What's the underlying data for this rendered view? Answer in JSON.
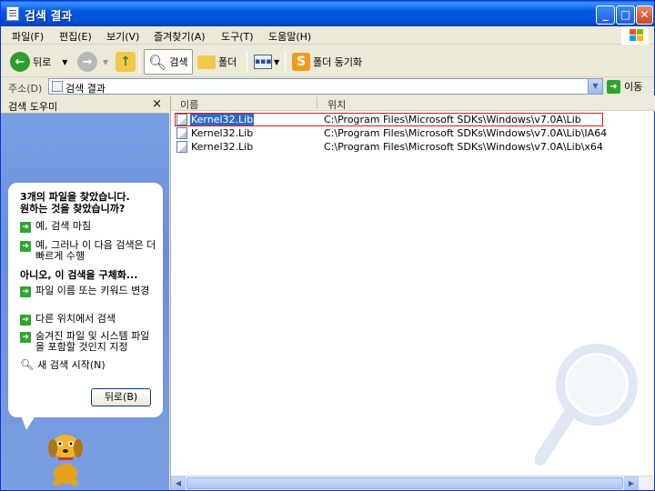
{
  "window": {
    "title": "검색 결과"
  },
  "menu": [
    "파일(F)",
    "편집(E)",
    "보기(V)",
    "즐겨찾기(A)",
    "도구(T)",
    "도움말(H)"
  ],
  "toolbar": {
    "back_label": "뒤로",
    "search_label": "검색",
    "folders_label": "폴더",
    "sync_label": "폴더 동기화"
  },
  "address": {
    "label": "주소(D)",
    "value": "검색 결과",
    "go_label": "이동"
  },
  "search_pane": {
    "title": "검색 도우미",
    "close": "×",
    "result_line1": "3개의 파일을 찾았습니다.",
    "result_line2": "원하는 것을 찾았습니까?",
    "yes_options": [
      "예, 검색 마침",
      "예, 그러나 이 다음 검색은 더 빠르게 수행"
    ],
    "no_heading": "아니오, 이 검색을 구체화...",
    "no_options": [
      "파일 이름 또는 키워드 변경",
      "다른 위치에서 검색",
      "숨겨진 파일 및 시스템 파일을 포함할 것인지 지정"
    ],
    "new_search": "새 검색 시작(N)",
    "back_button": "뒤로(B)"
  },
  "results": {
    "columns": [
      "이름",
      "위치"
    ],
    "rows": [
      {
        "name": "Kernel32.Lib",
        "location": "C:\\Program Files\\Microsoft SDKs\\Windows\\v7.0A\\Lib"
      },
      {
        "name": "Kernel32.Lib",
        "location": "C:\\Program Files\\Microsoft SDKs\\Windows\\v7.0A\\Lib\\IA64"
      },
      {
        "name": "Kernel32.Lib",
        "location": "C:\\Program Files\\Microsoft SDKs\\Windows\\v7.0A\\Lib\\x64"
      }
    ]
  },
  "colors": {
    "titlebar": "#0058e6",
    "selection": "#316ac5",
    "highlight_border": "#d61a1a",
    "pane_bg": "#7aa1e6"
  }
}
